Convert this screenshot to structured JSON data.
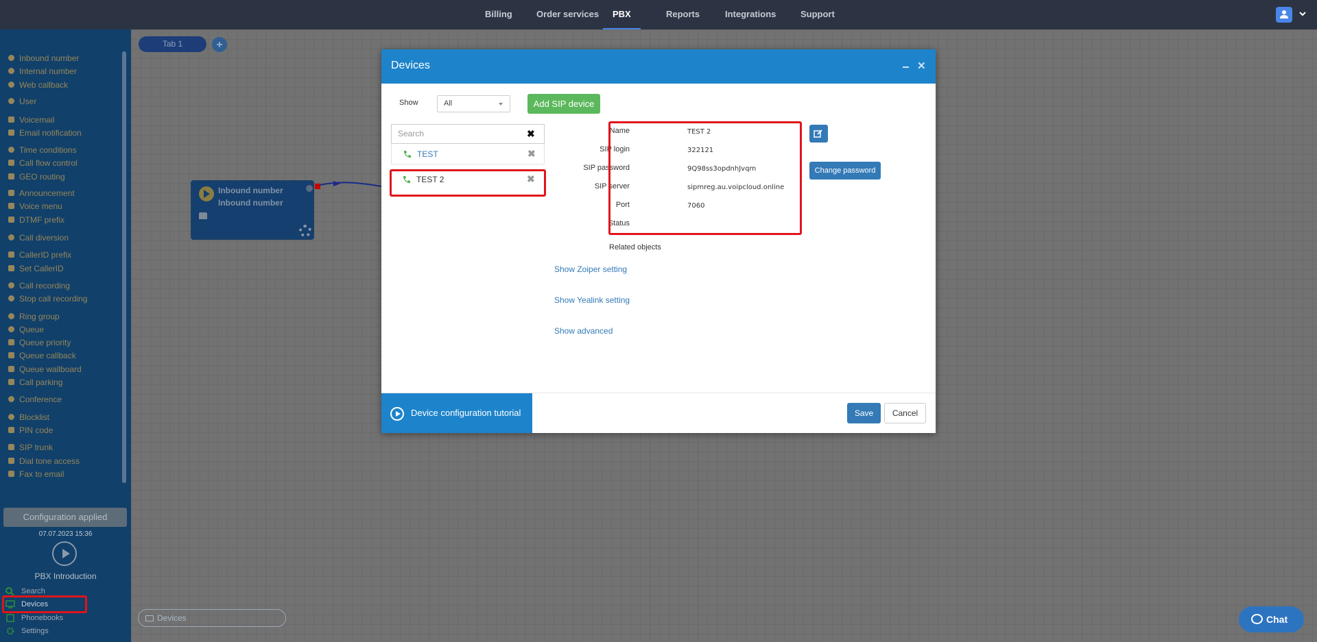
{
  "topnav": {
    "items": [
      {
        "label": "Billing",
        "active": false
      },
      {
        "label": "Order services",
        "active": false
      },
      {
        "label": "PBX",
        "active": true
      },
      {
        "label": "Reports",
        "active": false
      },
      {
        "label": "Integrations",
        "active": false
      },
      {
        "label": "Support",
        "active": false
      }
    ],
    "accent_color": "#4a86e8"
  },
  "sidebar": {
    "items": [
      {
        "label": "Inbound number",
        "icon": "arrow-circle-icon"
      },
      {
        "label": "Internal number",
        "icon": "map-pin-icon"
      },
      {
        "label": "Web callback",
        "icon": "undo-icon"
      },
      {
        "label": "User",
        "icon": "user-icon"
      },
      {
        "label": "Voicemail",
        "icon": "envelope-icon"
      },
      {
        "label": "Email notification",
        "icon": "bell-icon"
      },
      {
        "label": "Time conditions",
        "icon": "clock-icon"
      },
      {
        "label": "Call flow control",
        "icon": "toggle-icon"
      },
      {
        "label": "GEO routing",
        "icon": "sitemap-icon"
      },
      {
        "label": "Announcement",
        "icon": "megaphone-icon"
      },
      {
        "label": "Voice menu",
        "icon": "grid-icon"
      },
      {
        "label": "DTMF prefix",
        "icon": "code-icon"
      },
      {
        "label": "Call diversion",
        "icon": "redo-icon"
      },
      {
        "label": "CallerID prefix",
        "icon": "list-icon"
      },
      {
        "label": "Set CallerID",
        "icon": "list-icon"
      },
      {
        "label": "Call recording",
        "icon": "microphone-icon"
      },
      {
        "label": "Stop call recording",
        "icon": "microphone-slash-icon"
      },
      {
        "label": "Ring group",
        "icon": "users-icon"
      },
      {
        "label": "Queue",
        "icon": "user-plus-icon"
      },
      {
        "label": "Queue priority",
        "icon": "arrow-up-icon"
      },
      {
        "label": "Queue callback",
        "icon": "share-icon"
      },
      {
        "label": "Queue wallboard",
        "icon": "table-icon"
      },
      {
        "label": "Call parking",
        "icon": "parking-icon"
      },
      {
        "label": "Conference",
        "icon": "comments-icon"
      },
      {
        "label": "Blocklist",
        "icon": "ban-icon"
      },
      {
        "label": "PIN code",
        "icon": "key-icon"
      },
      {
        "label": "SIP trunk",
        "icon": "sitemap-icon"
      },
      {
        "label": "Dial tone access",
        "icon": "lock-icon"
      },
      {
        "label": "Fax to email",
        "icon": "fax-icon"
      }
    ],
    "config_label": "Configuration applied",
    "config_date": "07.07.2023 15:36",
    "intro_label": "PBX Introduction",
    "bottom_items": [
      {
        "label": "Search",
        "icon": "search-icon"
      },
      {
        "label": "Devices",
        "icon": "monitor-icon"
      },
      {
        "label": "Phonebooks",
        "icon": "book-icon"
      },
      {
        "label": "Settings",
        "icon": "gear-icon"
      }
    ]
  },
  "canvas": {
    "tab_label": "Tab 1",
    "node": {
      "line1": "Inbound number",
      "line2": "Inbound number"
    },
    "devices_pill": "Devices"
  },
  "modal": {
    "title": "Devices",
    "show_label": "Show",
    "show_value": "All",
    "add_button": "Add SIP device",
    "search_placeholder": "Search",
    "devices": [
      {
        "name": "TEST",
        "selected": false
      },
      {
        "name": "TEST 2",
        "selected": true
      }
    ],
    "details": {
      "name_label": "Name",
      "name_value": "TEST 2",
      "login_label": "SIP login",
      "login_value": "322121",
      "password_label": "SIP password",
      "password_value": "9Q98ss3opdnhJvqm",
      "server_label": "SIP server",
      "server_value": "sipmreg.au.voipcloud.online",
      "port_label": "Port",
      "port_value": "7060",
      "status_label": "Status",
      "status_value": ""
    },
    "change_password": "Change password",
    "related_objects": "Related objects",
    "links": {
      "zoiper": "Show Zoiper setting",
      "yealink": "Show Yealink setting",
      "advanced": "Show advanced"
    },
    "tutorial": "Device configuration tutorial",
    "save": "Save",
    "cancel": "Cancel"
  },
  "chat": {
    "label": "Chat"
  }
}
